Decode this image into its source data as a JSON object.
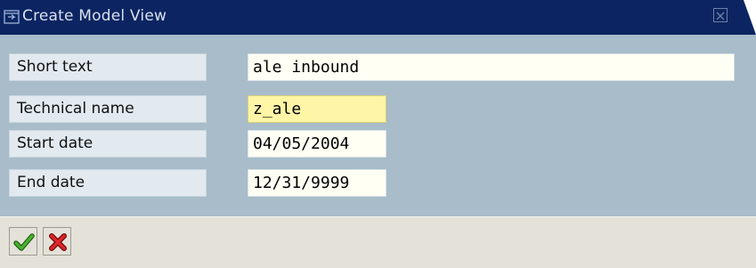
{
  "window": {
    "title": "Create Model View",
    "close_label": "Close"
  },
  "form": {
    "short_text": {
      "label": "Short text",
      "value": "ale inbound"
    },
    "technical_name": {
      "label": "Technical name",
      "value": "z_ale"
    },
    "start_date": {
      "label": "Start date",
      "value": "04/05/2004"
    },
    "end_date": {
      "label": "End date",
      "value": "12/31/9999"
    }
  },
  "toolbar": {
    "confirm_icon": "checkmark-icon",
    "cancel_icon": "cancel-x-icon"
  },
  "colors": {
    "titlebar": "#0c2562",
    "body": "#a8bcc9",
    "focused_field": "#fff5a6",
    "confirm_green": "#2f8a1f",
    "cancel_red": "#c1151a"
  }
}
